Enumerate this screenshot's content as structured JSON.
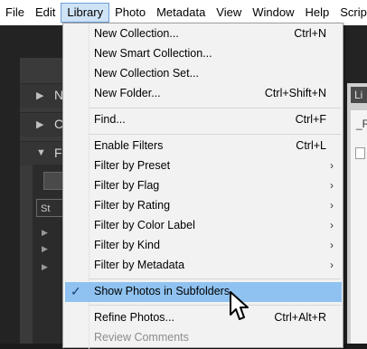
{
  "menubar": {
    "items": [
      {
        "label": "File"
      },
      {
        "label": "Edit"
      },
      {
        "label": "Library"
      },
      {
        "label": "Photo"
      },
      {
        "label": "Metadata"
      },
      {
        "label": "View"
      },
      {
        "label": "Window"
      },
      {
        "label": "Help"
      },
      {
        "label": "Scripts"
      }
    ]
  },
  "background": {
    "panel_letters": [
      "N",
      "C",
      "F"
    ],
    "filter_chip": "St",
    "right_tab": "Li",
    "right_doc_text": "_R"
  },
  "library_menu": {
    "items": [
      {
        "label": "New Collection...",
        "shortcut": "Ctrl+N"
      },
      {
        "label": "New Smart Collection...",
        "shortcut": ""
      },
      {
        "label": "New Collection Set...",
        "shortcut": ""
      },
      {
        "label": "New Folder...",
        "shortcut": "Ctrl+Shift+N"
      },
      {
        "label": "Find...",
        "shortcut": "Ctrl+F"
      },
      {
        "label": "Enable Filters",
        "shortcut": "Ctrl+L"
      },
      {
        "label": "Filter by Preset",
        "submenu": true
      },
      {
        "label": "Filter by Flag",
        "submenu": true
      },
      {
        "label": "Filter by Rating",
        "submenu": true
      },
      {
        "label": "Filter by Color Label",
        "submenu": true
      },
      {
        "label": "Filter by Kind",
        "submenu": true
      },
      {
        "label": "Filter by Metadata",
        "submenu": true
      },
      {
        "label": "Show Photos in Subfolders",
        "checked": true,
        "highlighted": true
      },
      {
        "label": "Refine Photos...",
        "shortcut": "Ctrl+Alt+R"
      },
      {
        "label": "Review Comments",
        "disabled": true
      }
    ]
  },
  "colors": {
    "highlight": "#8fc2f0",
    "menu_bg": "#f2f2f2",
    "active_menubar": "#cfe3f7"
  }
}
